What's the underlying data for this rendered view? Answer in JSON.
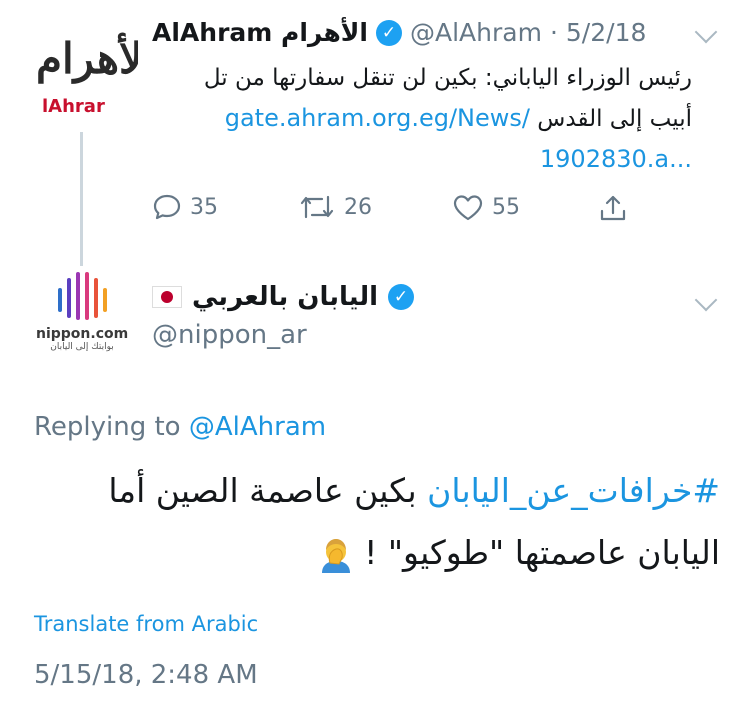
{
  "tweet1": {
    "display_name": "AlAhram الأهرام",
    "handle": "@AlAhram",
    "separator": "·",
    "date": "5/2/18",
    "avatar_logo_text": "الأهرام",
    "avatar_sub": "lAhrar",
    "text_line1": "رئيس الوزراء الياباني: بكين لن تنقل سفارتها من تل",
    "text_line2_ar": "أبيب إلى القدس",
    "link_line1": "gate.ahram.org.eg/News/",
    "link_line2": "1902830.a...",
    "replies": "35",
    "retweets": "26",
    "likes": "55"
  },
  "tweet2": {
    "display_name": "اليابان بالعربي",
    "handle": "@nippon_ar",
    "avatar_caption": "nippon.com",
    "avatar_subcaption": "بوابتك إلى اليابان",
    "replying_label": "Replying to",
    "replying_handle": "@AlAhram",
    "hashtag": "#خرافات_عن_اليابان",
    "body_line1_rest": "بكين عاصمة الصين أما",
    "body_line2": "اليابان عاصمتها \"طوكيو\" !",
    "translate": "Translate from Arabic",
    "timestamp": "5/15/18, 2:48 AM"
  },
  "colors": {
    "link": "#1b95e0",
    "muted": "#657786",
    "verified": "#1da1f2"
  },
  "icons": [
    "verified-badge-icon",
    "chevron-down-icon",
    "reply-icon",
    "retweet-icon",
    "like-icon",
    "share-icon",
    "japan-flag-icon",
    "facepalm-emoji-icon"
  ]
}
